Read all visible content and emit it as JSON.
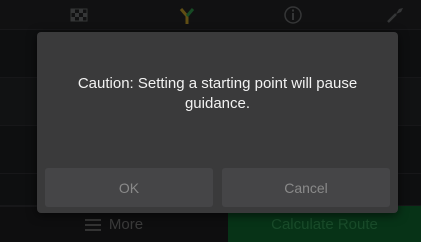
{
  "toolbar": {
    "icons": [
      "checkered-flag-icon",
      "route-fork-icon",
      "info-icon",
      "tools-icon"
    ]
  },
  "dialog": {
    "message": "Caution: Setting a starting point will pause guidance.",
    "ok_label": "OK",
    "cancel_label": "Cancel"
  },
  "bottom_bar": {
    "more_label": "More",
    "calculate_label": "Calculate Route"
  },
  "colors": {
    "dialog_bg": "#3a3a3b",
    "button_bg": "#454547",
    "calculate_green": "#0e5d2b"
  }
}
